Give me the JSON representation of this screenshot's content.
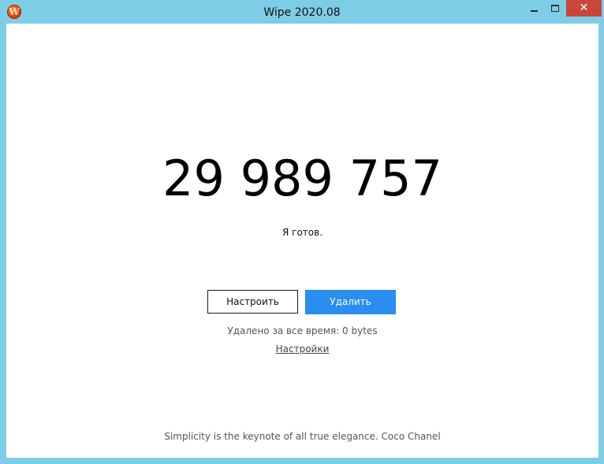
{
  "window": {
    "title": "Wipe 2020.08",
    "icon": "wipe-app-icon",
    "icon_letter": "W",
    "close_glyph": "✕",
    "close_color": "#c7473b",
    "frame_color": "#7ecde6"
  },
  "main": {
    "counter": "29 989 757",
    "status": "Я готов.",
    "configure_label": "Настроить",
    "delete_label": "Удалить",
    "delete_color": "#2a8df0",
    "total_deleted": "Удалено за все время: 0 bytes",
    "settings_link": "Настройки"
  },
  "footer": {
    "quote": "Simplicity is the keynote of all true elegance. Coco Chanel"
  }
}
